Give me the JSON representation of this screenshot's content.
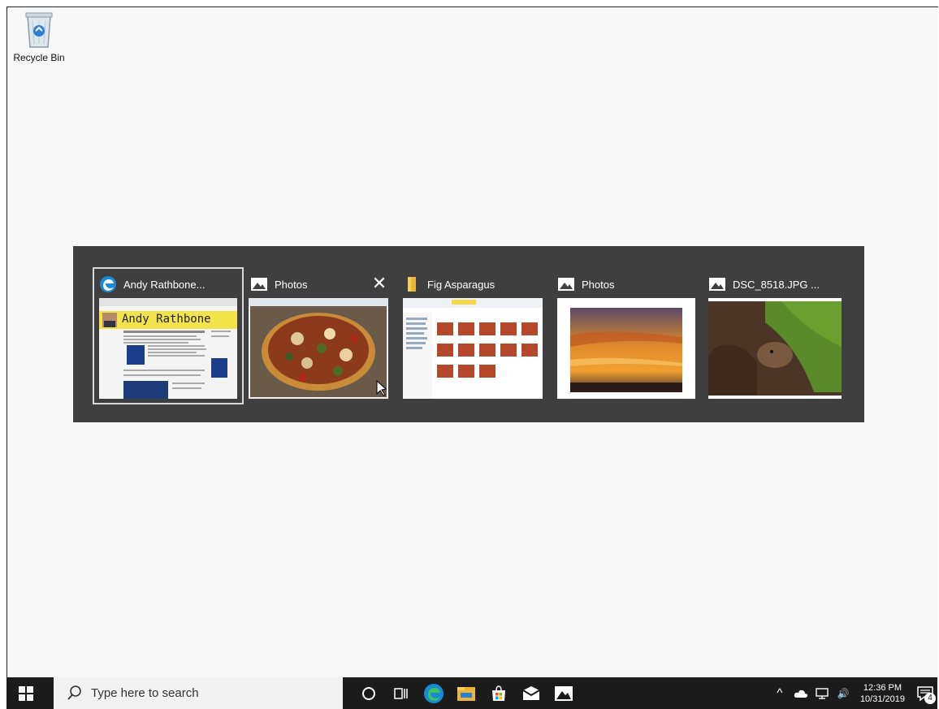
{
  "desktop": {
    "icons": [
      {
        "label": "Recycle Bin",
        "icon": "recycle-bin-icon"
      }
    ]
  },
  "switcher": {
    "windows": [
      {
        "title": "Andy Rathbone...",
        "icon": "edge-icon",
        "selected": true,
        "preview_banner": "Andy Rathbone"
      },
      {
        "title": "Photos",
        "icon": "photos-icon",
        "selected": false,
        "close_label": "✕"
      },
      {
        "title": "Fig Asparagus",
        "icon": "folder-icon",
        "selected": false
      },
      {
        "title": "Photos",
        "icon": "photos-icon",
        "selected": false
      },
      {
        "title": "DSC_8518.JPG ...",
        "icon": "photos-icon",
        "selected": false
      }
    ]
  },
  "taskbar": {
    "search_placeholder": "Type here to search",
    "apps": [
      "cortana-icon",
      "task-view-icon",
      "edge-icon",
      "file-explorer-icon",
      "store-icon",
      "mail-icon",
      "photos-icon"
    ],
    "tray": {
      "chevron": "^",
      "volume": "🔊",
      "time": "12:36 PM",
      "date": "10/31/2019",
      "notification_count": "4"
    }
  }
}
